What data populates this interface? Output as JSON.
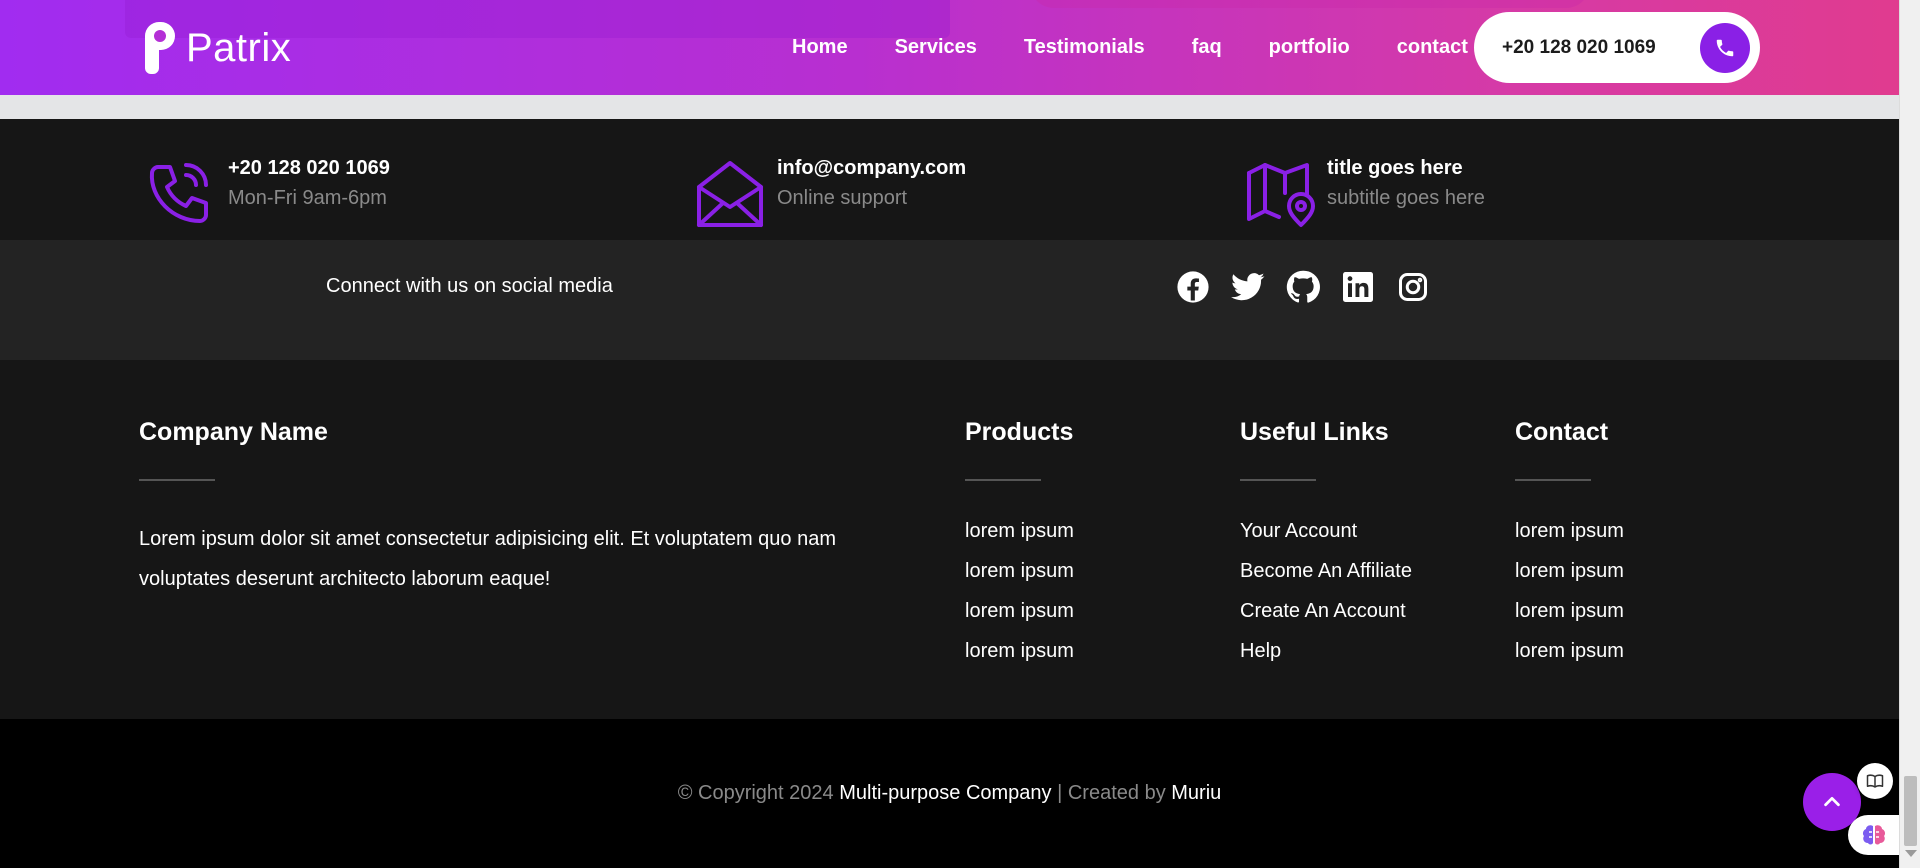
{
  "brand": {
    "name": "Patrix"
  },
  "nav": {
    "links": [
      "Home",
      "Services",
      "Testimonials",
      "faq",
      "portfolio",
      "contact"
    ],
    "phone": "+20 128 020 1069"
  },
  "contact_strip": [
    {
      "icon": "phone-call-icon",
      "title": "+20 128 020 1069",
      "subtitle": "Mon-Fri 9am-6pm"
    },
    {
      "icon": "envelope-open-icon",
      "title": "info@company.com",
      "subtitle": "Online support"
    },
    {
      "icon": "map-pin-icon",
      "title": "title goes here",
      "subtitle": "subtitle goes here"
    }
  ],
  "social": {
    "text": "Connect with us on social media",
    "icons": [
      "facebook-icon",
      "twitter-icon",
      "github-icon",
      "linkedin-icon",
      "instagram-icon"
    ]
  },
  "footer": {
    "about": {
      "heading": "Company Name",
      "text": "Lorem ipsum dolor sit amet consectetur adipisicing elit. Et voluptatem quo nam voluptates deserunt architecto laborum eaque!"
    },
    "columns": [
      {
        "heading": "Products",
        "links": [
          "lorem ipsum",
          "lorem ipsum",
          "lorem ipsum",
          "lorem ipsum"
        ]
      },
      {
        "heading": "Useful Links",
        "links": [
          "Your Account",
          "Become An Affiliate",
          "Create An Account",
          "Help"
        ]
      },
      {
        "heading": "Contact",
        "links": [
          "lorem ipsum",
          "lorem ipsum",
          "lorem ipsum",
          "lorem ipsum"
        ]
      }
    ]
  },
  "copyright": {
    "prefix": "© Copyright 2024",
    "company": "Multi-purpose Company",
    "separator": "| Created by",
    "author": "Muriu"
  },
  "colors": {
    "accent": "#9a1fe8",
    "gradient_start": "#a12cf0",
    "gradient_end": "#e03b8f",
    "footer_bg": "#161616",
    "social_bg": "#232323"
  }
}
